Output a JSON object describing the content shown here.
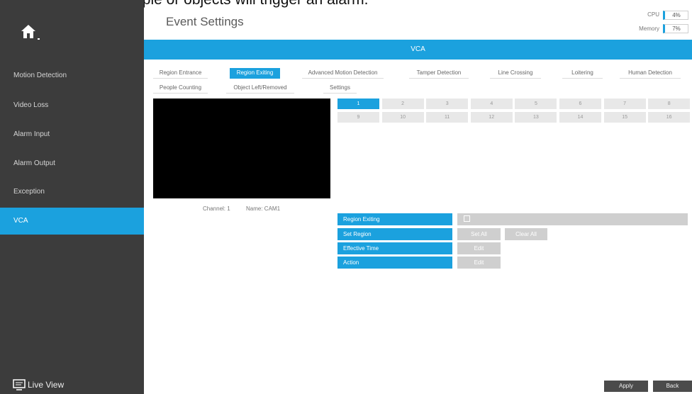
{
  "doc_text": "terval. Any exit of people or objects will trigger an alarm.",
  "header": {
    "title": "Event Settings",
    "cpu_label": "CPU",
    "cpu_value": "4%",
    "memory_label": "Memory",
    "memory_value": "7%"
  },
  "sidebar": {
    "items": [
      {
        "label": "Motion Detection"
      },
      {
        "label": "Video Loss"
      },
      {
        "label": "Alarm Input"
      },
      {
        "label": "Alarm Output"
      },
      {
        "label": "Exception"
      },
      {
        "label": "VCA"
      }
    ],
    "live_view": "Live View"
  },
  "vca_title": "VCA",
  "tabs": [
    "Region Entrance",
    "Region Exiting",
    "Advanced Motion Detection",
    "Tamper Detection",
    "Line Crossing",
    "Loitering",
    "Human Detection",
    "People Counting",
    "Object Left/Removed",
    "Settings"
  ],
  "preview": {
    "channel": "Channel: 1",
    "name": "Name: CAM1"
  },
  "channels": [
    "1",
    "2",
    "3",
    "4",
    "5",
    "6",
    "7",
    "8",
    "9",
    "10",
    "11",
    "12",
    "13",
    "14",
    "15",
    "16"
  ],
  "settings": {
    "region_exiting": "Region Exiting",
    "set_region": "Set Region",
    "effective_time": "Effective Time",
    "action": "Action",
    "set_all": "Set All",
    "clear_all": "Clear All",
    "edit_time": "Edit",
    "edit_action": "Edit"
  },
  "buttons": {
    "apply": "Apply",
    "back": "Back"
  },
  "colors": {
    "accent": "#1ba1de",
    "sidebar": "#3c3c3c"
  }
}
